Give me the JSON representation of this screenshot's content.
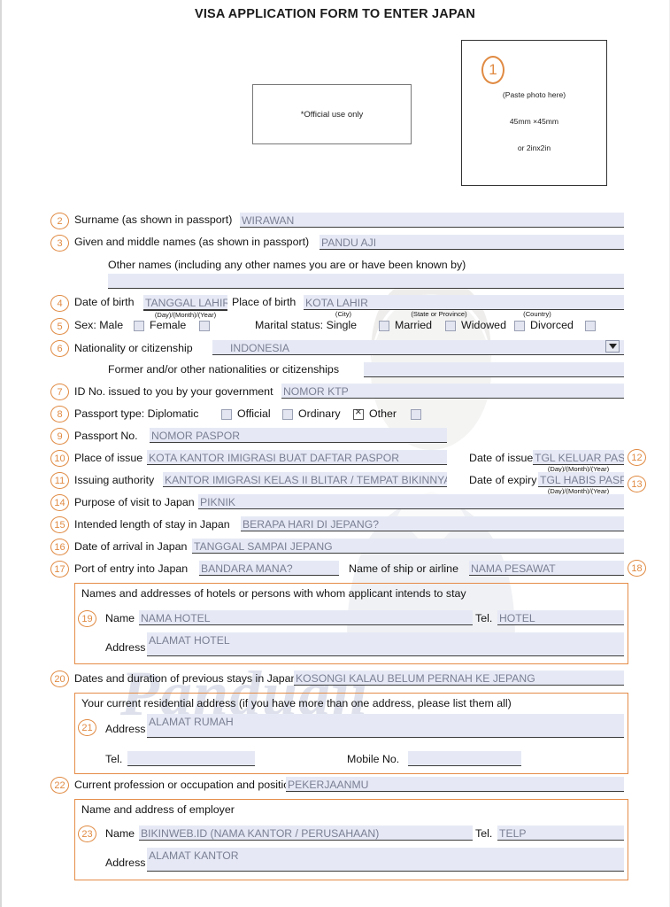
{
  "document": {
    "title": "VISA APPLICATION FORM TO ENTER JAPAN",
    "official_use": "*Official use only",
    "watermark": "Panduaji",
    "accent_color": "#e58c48",
    "field_bg_color": "#e6e9f5",
    "field_text_color": "#7a7f93"
  },
  "photo": {
    "number": "1",
    "line1": "(Paste photo here)",
    "line2": "45mm ×45mm",
    "line3": "or 2inx2in"
  },
  "fields": {
    "f2": {
      "number": "2",
      "label": "Surname (as shown in passport)",
      "value": "WIRAWAN"
    },
    "f3": {
      "number": "3",
      "label": "Given and middle names (as shown in passport)",
      "value": "PANDU AJI"
    },
    "other_names": {
      "label": "Other names (including any other names you are or have been known by)",
      "value": ""
    },
    "f4": {
      "number": "4",
      "label_dob": "Date of birth",
      "value_dob": "TANGGAL LAHIR",
      "sub_dob": "(Day)/(Month)/(Year)",
      "label_pob": "Place of birth",
      "value_pob": "KOTA LAHIR",
      "sub_city": "(City)",
      "sub_state": "(State or Province)",
      "sub_country": "(Country)"
    },
    "f5": {
      "number": "5",
      "label_sex": "Sex: Male",
      "opt_female": "Female",
      "label_marital": "Marital status: Single",
      "opt_married": "Married",
      "opt_widowed": "Widowed",
      "opt_divorced": "Divorced",
      "checked": ""
    },
    "f6": {
      "number": "6",
      "label": "Nationality or citizenship",
      "value": "INDONESIA",
      "dropdown_icon": "chevron-down-icon"
    },
    "former_nat": {
      "label": "Former and/or other nationalities or citizenships",
      "value": ""
    },
    "f7": {
      "number": "7",
      "label": "ID No. issued to you by your government",
      "value": "NOMOR KTP"
    },
    "f8": {
      "number": "8",
      "label": "Passport type: Diplomatic",
      "opt_official": "Official",
      "opt_ordinary": "Ordinary",
      "opt_other": "Other",
      "checked": "Ordinary"
    },
    "f9": {
      "number": "9",
      "label": "Passport No.",
      "value": "NOMOR PASPOR"
    },
    "f10": {
      "number": "10",
      "label": "Place of issue",
      "value": "KOTA KANTOR IMIGRASI BUAT DAFTAR PASPOR"
    },
    "f11": {
      "number": "11",
      "label": "Issuing authority",
      "value": "KANTOR IMIGRASI KELAS II BLITAR / TEMPAT BIKINNYA"
    },
    "f12": {
      "number": "12",
      "label": "Date of issue",
      "value": "TGL KELUAR PAS",
      "sub": "(Day)/(Month)/(Year)"
    },
    "f13": {
      "number": "13",
      "label": "Date of expiry",
      "value": "TGL HABIS PASP",
      "sub": "(Day)/(Month)/(Year)"
    },
    "f14": {
      "number": "14",
      "label": "Purpose of visit to Japan",
      "value": "PIKNIK"
    },
    "f15": {
      "number": "15",
      "label": "Intended length of stay in Japan",
      "value": "BERAPA HARI DI JEPANG?"
    },
    "f16": {
      "number": "16",
      "label": "Date of arrival in Japan",
      "value": "TANGGAL SAMPAI JEPANG"
    },
    "f17": {
      "number": "17",
      "label": "Port of entry into Japan",
      "value": "BANDARA MANA?"
    },
    "f18": {
      "number": "18",
      "label": "Name of ship or airline",
      "value": "NAMA PESAWAT"
    },
    "hotel_group": {
      "heading": "Names and addresses of hotels or persons with whom applicant intends to stay",
      "number": "19",
      "label_name": "Name",
      "value_name": "NAMA HOTEL",
      "label_tel": "Tel.",
      "value_tel": "HOTEL",
      "label_address": "Address",
      "value_address": "ALAMAT HOTEL"
    },
    "f20": {
      "number": "20",
      "label": "Dates and duration of previous stays in Japan",
      "value": "KOSONGI KALAU BELUM PERNAH KE JEPANG"
    },
    "residence_group": {
      "heading": "Your current residential address (if you have more than one address, please list them all)",
      "number": "21",
      "label_address": "Address",
      "value_address": "ALAMAT RUMAH",
      "label_tel": "Tel.",
      "value_tel": "",
      "label_mobile": "Mobile No.",
      "value_mobile": ""
    },
    "f22": {
      "number": "22",
      "label": "Current profession or occupation and position",
      "value": "PEKERJAANMU"
    },
    "employer_group": {
      "heading": "Name and address of employer",
      "number": "23",
      "label_name": "Name",
      "value_name": "BIKINWEB.ID (NAMA KANTOR / PERUSAHAAN)",
      "label_tel": "Tel.",
      "value_tel": "TELP",
      "label_address": "Address",
      "value_address": "ALAMAT KANTOR"
    }
  }
}
